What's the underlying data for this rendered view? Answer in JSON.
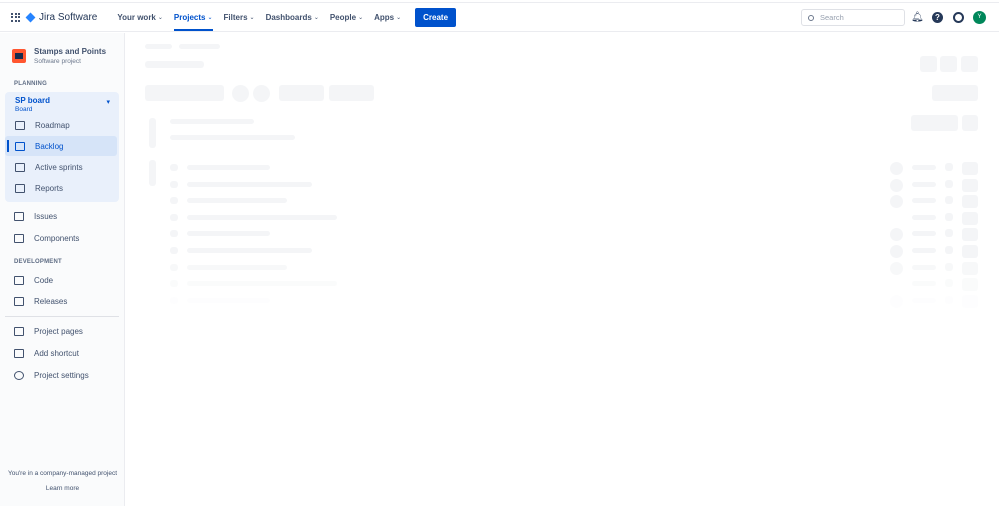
{
  "topbar": {
    "product": "Jira Software",
    "nav": [
      {
        "label": "Your work"
      },
      {
        "label": "Projects",
        "active": true
      },
      {
        "label": "Filters"
      },
      {
        "label": "Dashboards"
      },
      {
        "label": "People"
      },
      {
        "label": "Apps"
      }
    ],
    "create": "Create",
    "search_placeholder": "Search",
    "avatar_initial": "Y",
    "help_glyph": "?"
  },
  "sidebar": {
    "project_name": "Stamps and Points",
    "project_type": "Software project",
    "planning_heading": "PLANNING",
    "board_name": "SP board",
    "board_type": "Board",
    "board_items": [
      {
        "label": "Roadmap",
        "icon": "roadmap-icon"
      },
      {
        "label": "Backlog",
        "icon": "backlog-icon",
        "selected": true
      },
      {
        "label": "Active sprints",
        "icon": "columns-icon"
      },
      {
        "label": "Reports",
        "icon": "chart-icon"
      }
    ],
    "items": [
      {
        "label": "Issues",
        "icon": "issues-icon"
      },
      {
        "label": "Components",
        "icon": "components-icon"
      }
    ],
    "development_heading": "DEVELOPMENT",
    "dev_items": [
      {
        "label": "Code",
        "icon": "code-icon"
      },
      {
        "label": "Releases",
        "icon": "ship-icon"
      }
    ],
    "bottom_items": [
      {
        "label": "Project pages",
        "icon": "page-icon"
      },
      {
        "label": "Add shortcut",
        "icon": "add-shortcut-icon"
      },
      {
        "label": "Project settings",
        "icon": "gear-icon"
      }
    ],
    "footer_text": "You're in a company-managed project",
    "learn_more": "Learn more"
  },
  "colors": {
    "accent": "#0052cc",
    "avatar": "#00875a",
    "project": "#ff5630"
  }
}
